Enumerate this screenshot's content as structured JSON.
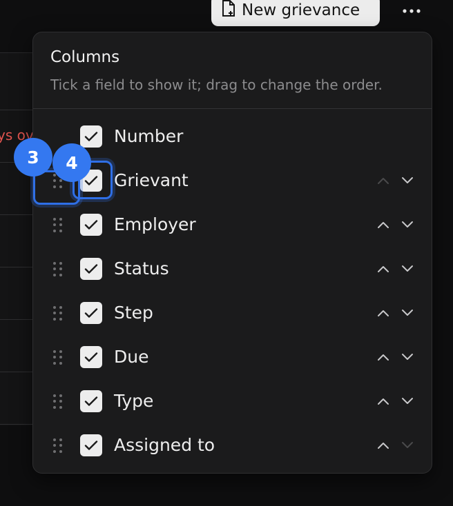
{
  "toolbar": {
    "new_label": "New grievance",
    "new_icon": "file-plus-icon",
    "more_icon": "more-horizontal-icon"
  },
  "background": {
    "overdue_text": "ys ov"
  },
  "popover": {
    "title": "Columns",
    "subtitle": "Tick a field to show it; drag to change the order.",
    "columns": [
      {
        "label": "Number",
        "checked": true,
        "draggable": false,
        "up": false,
        "down": false
      },
      {
        "label": "Grievant",
        "checked": true,
        "draggable": true,
        "up": false,
        "down": true
      },
      {
        "label": "Employer",
        "checked": true,
        "draggable": true,
        "up": true,
        "down": true
      },
      {
        "label": "Status",
        "checked": true,
        "draggable": true,
        "up": true,
        "down": true
      },
      {
        "label": "Step",
        "checked": true,
        "draggable": true,
        "up": true,
        "down": true
      },
      {
        "label": "Due",
        "checked": true,
        "draggable": true,
        "up": true,
        "down": true
      },
      {
        "label": "Type",
        "checked": true,
        "draggable": true,
        "up": true,
        "down": true
      },
      {
        "label": "Assigned to",
        "checked": true,
        "draggable": true,
        "up": true,
        "down": false
      }
    ]
  },
  "markers": [
    {
      "number": "3",
      "target": "grip-handle-grievant"
    },
    {
      "number": "4",
      "target": "checkbox-grievant"
    }
  ],
  "colors": {
    "accent": "#3478f0",
    "overdue": "#e0544f",
    "panel": "#1b1b1c"
  }
}
